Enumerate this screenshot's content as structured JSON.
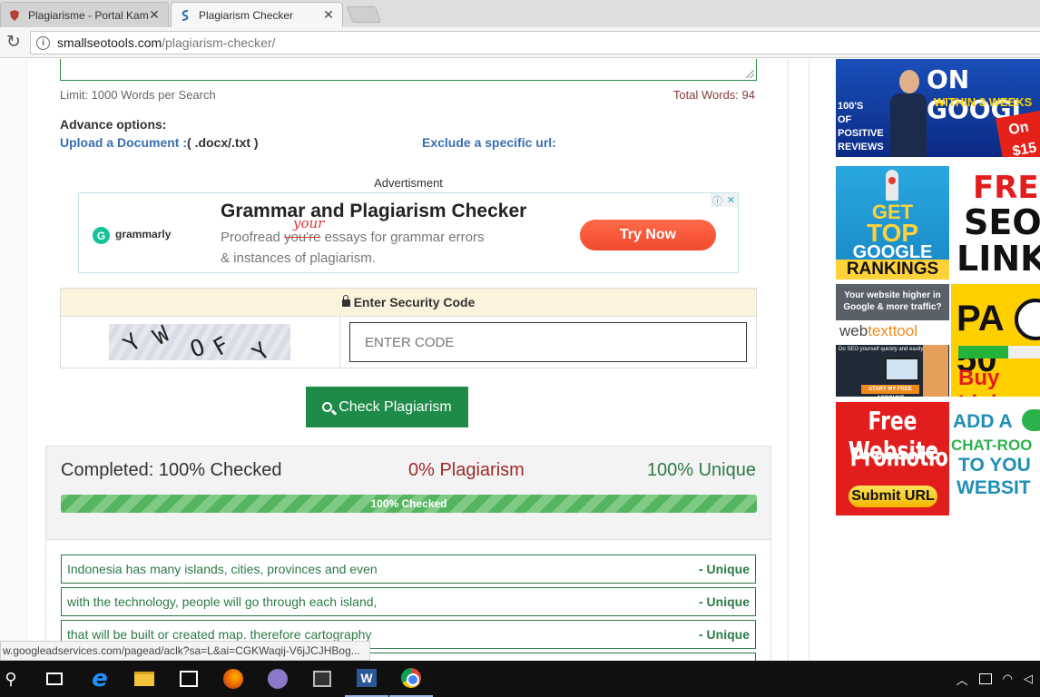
{
  "browser": {
    "tabs": [
      {
        "title": "Plagiarisme - Portal Kam",
        "active": false
      },
      {
        "title": "Plagiarism Checker",
        "active": true
      }
    ],
    "url_host": "smallseotools.com",
    "url_path": "/plagiarism-checker/"
  },
  "page": {
    "limit_text": "Limit: 1000 Words per Search",
    "total_words": "Total Words: 94",
    "advance_title": "Advance options:",
    "upload_link": "Upload a Document :",
    "upload_ext": "( .docx/.txt )",
    "exclude_link": "Exclude a specific url:",
    "advert_label": "Advertisment",
    "ad": {
      "brand": "grammarly",
      "headline": "Grammar and Plagiarism Checker",
      "line1_a": "Proofread ",
      "line1_struck": "you're",
      "line1_hand": "your",
      "line1_b": " essays for grammar errors",
      "line2": "& instances of plagiarism.",
      "cta": "Try Now"
    },
    "security": {
      "title": "Enter Security Code",
      "captcha_letters": [
        "Y",
        "W",
        "O",
        "F",
        "Y"
      ],
      "input_placeholder": "ENTER CODE"
    },
    "check_button": "Check Plagiarism",
    "results": {
      "completed": "Completed: 100% Checked",
      "plagiarism": "0% Plagiarism",
      "unique": "100% Unique",
      "progress_label": "100% Checked",
      "progress_fraction": 1.0
    },
    "sentences": [
      {
        "text": "Indonesia has many islands, cities, provinces and even",
        "status": "- Unique"
      },
      {
        "text": "with the technology, people will go through each island,",
        "status": "- Unique"
      },
      {
        "text": "that will be built or created map. therefore cartography",
        "status": "- Unique"
      }
    ],
    "status_url": "w.googleadservices.com/pagead/aclk?sa=L&ai=CGKWaqij-V6jJCJHBog..."
  },
  "side_ads": {
    "a1": {
      "big": "ON GOOGL",
      "yellow": "WITHIN 3 WEEKS",
      "left_lines": [
        "100'S",
        "OF",
        "POSITIVE",
        "REVIEWS"
      ],
      "price": [
        "On",
        "$15"
      ]
    },
    "a2": {
      "l1": "GET",
      "l2": "TOP",
      "l3": "GOOGLE",
      "l4": "RANKINGS"
    },
    "a3": {
      "l1": "FREE",
      "l2": "SEO",
      "l3": "LINKS"
    },
    "a4": {
      "top": "Your website higher in Google & more traffic?",
      "brand_a": "web",
      "brand_b": "texttool",
      "sub": "Do SEO yourself quickly and easily",
      "btn": "START MY FREE ACCOUNT"
    },
    "a5": {
      "l1": "PA 50",
      "l2": "Buy Link"
    },
    "a6": {
      "l1": "Free Website",
      "l2": "Promotion",
      "btn": "Submit URL"
    },
    "a7": {
      "l1": "ADD A",
      "l2": "CHAT-ROO",
      "l3": "TO YOU",
      "l4": "WEBSIT"
    }
  },
  "taskbar": {
    "word_letter": "W"
  },
  "colors": {
    "accent_green": "#1f8b48",
    "unique_green": "#2c7a46",
    "plag_red": "#9a2a2a",
    "link_blue": "#3a6fb0"
  }
}
